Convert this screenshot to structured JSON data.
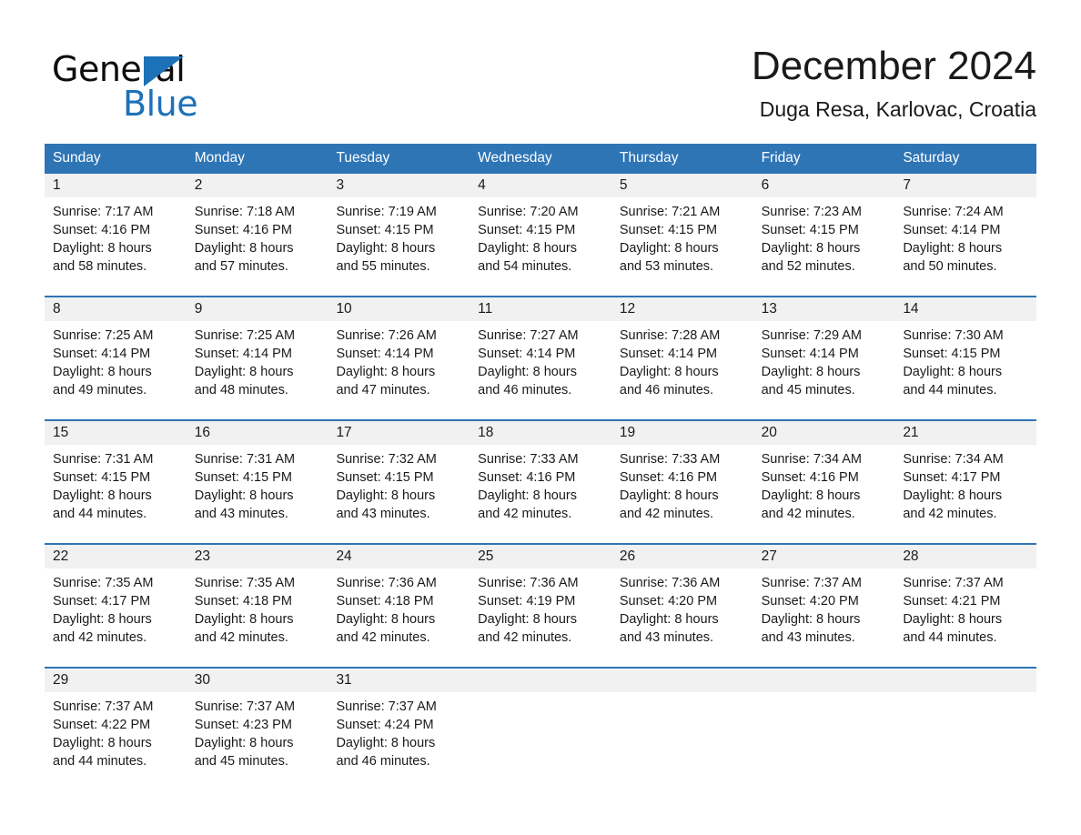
{
  "brand": {
    "name_part1": "General",
    "name_part2": "Blue",
    "triangle_color": "#1d71b8",
    "accent_color": "#2e75b6"
  },
  "header": {
    "month_title": "December 2024",
    "location": "Duga Resa, Karlovac, Croatia"
  },
  "calendar": {
    "weekdays": [
      "Sunday",
      "Monday",
      "Tuesday",
      "Wednesday",
      "Thursday",
      "Friday",
      "Saturday"
    ],
    "weeks": [
      {
        "days": [
          {
            "num": "1",
            "sunrise": "Sunrise: 7:17 AM",
            "sunset": "Sunset: 4:16 PM",
            "daylight1": "Daylight: 8 hours",
            "daylight2": "and 58 minutes."
          },
          {
            "num": "2",
            "sunrise": "Sunrise: 7:18 AM",
            "sunset": "Sunset: 4:16 PM",
            "daylight1": "Daylight: 8 hours",
            "daylight2": "and 57 minutes."
          },
          {
            "num": "3",
            "sunrise": "Sunrise: 7:19 AM",
            "sunset": "Sunset: 4:15 PM",
            "daylight1": "Daylight: 8 hours",
            "daylight2": "and 55 minutes."
          },
          {
            "num": "4",
            "sunrise": "Sunrise: 7:20 AM",
            "sunset": "Sunset: 4:15 PM",
            "daylight1": "Daylight: 8 hours",
            "daylight2": "and 54 minutes."
          },
          {
            "num": "5",
            "sunrise": "Sunrise: 7:21 AM",
            "sunset": "Sunset: 4:15 PM",
            "daylight1": "Daylight: 8 hours",
            "daylight2": "and 53 minutes."
          },
          {
            "num": "6",
            "sunrise": "Sunrise: 7:23 AM",
            "sunset": "Sunset: 4:15 PM",
            "daylight1": "Daylight: 8 hours",
            "daylight2": "and 52 minutes."
          },
          {
            "num": "7",
            "sunrise": "Sunrise: 7:24 AM",
            "sunset": "Sunset: 4:14 PM",
            "daylight1": "Daylight: 8 hours",
            "daylight2": "and 50 minutes."
          }
        ]
      },
      {
        "days": [
          {
            "num": "8",
            "sunrise": "Sunrise: 7:25 AM",
            "sunset": "Sunset: 4:14 PM",
            "daylight1": "Daylight: 8 hours",
            "daylight2": "and 49 minutes."
          },
          {
            "num": "9",
            "sunrise": "Sunrise: 7:25 AM",
            "sunset": "Sunset: 4:14 PM",
            "daylight1": "Daylight: 8 hours",
            "daylight2": "and 48 minutes."
          },
          {
            "num": "10",
            "sunrise": "Sunrise: 7:26 AM",
            "sunset": "Sunset: 4:14 PM",
            "daylight1": "Daylight: 8 hours",
            "daylight2": "and 47 minutes."
          },
          {
            "num": "11",
            "sunrise": "Sunrise: 7:27 AM",
            "sunset": "Sunset: 4:14 PM",
            "daylight1": "Daylight: 8 hours",
            "daylight2": "and 46 minutes."
          },
          {
            "num": "12",
            "sunrise": "Sunrise: 7:28 AM",
            "sunset": "Sunset: 4:14 PM",
            "daylight1": "Daylight: 8 hours",
            "daylight2": "and 46 minutes."
          },
          {
            "num": "13",
            "sunrise": "Sunrise: 7:29 AM",
            "sunset": "Sunset: 4:14 PM",
            "daylight1": "Daylight: 8 hours",
            "daylight2": "and 45 minutes."
          },
          {
            "num": "14",
            "sunrise": "Sunrise: 7:30 AM",
            "sunset": "Sunset: 4:15 PM",
            "daylight1": "Daylight: 8 hours",
            "daylight2": "and 44 minutes."
          }
        ]
      },
      {
        "days": [
          {
            "num": "15",
            "sunrise": "Sunrise: 7:31 AM",
            "sunset": "Sunset: 4:15 PM",
            "daylight1": "Daylight: 8 hours",
            "daylight2": "and 44 minutes."
          },
          {
            "num": "16",
            "sunrise": "Sunrise: 7:31 AM",
            "sunset": "Sunset: 4:15 PM",
            "daylight1": "Daylight: 8 hours",
            "daylight2": "and 43 minutes."
          },
          {
            "num": "17",
            "sunrise": "Sunrise: 7:32 AM",
            "sunset": "Sunset: 4:15 PM",
            "daylight1": "Daylight: 8 hours",
            "daylight2": "and 43 minutes."
          },
          {
            "num": "18",
            "sunrise": "Sunrise: 7:33 AM",
            "sunset": "Sunset: 4:16 PM",
            "daylight1": "Daylight: 8 hours",
            "daylight2": "and 42 minutes."
          },
          {
            "num": "19",
            "sunrise": "Sunrise: 7:33 AM",
            "sunset": "Sunset: 4:16 PM",
            "daylight1": "Daylight: 8 hours",
            "daylight2": "and 42 minutes."
          },
          {
            "num": "20",
            "sunrise": "Sunrise: 7:34 AM",
            "sunset": "Sunset: 4:16 PM",
            "daylight1": "Daylight: 8 hours",
            "daylight2": "and 42 minutes."
          },
          {
            "num": "21",
            "sunrise": "Sunrise: 7:34 AM",
            "sunset": "Sunset: 4:17 PM",
            "daylight1": "Daylight: 8 hours",
            "daylight2": "and 42 minutes."
          }
        ]
      },
      {
        "days": [
          {
            "num": "22",
            "sunrise": "Sunrise: 7:35 AM",
            "sunset": "Sunset: 4:17 PM",
            "daylight1": "Daylight: 8 hours",
            "daylight2": "and 42 minutes."
          },
          {
            "num": "23",
            "sunrise": "Sunrise: 7:35 AM",
            "sunset": "Sunset: 4:18 PM",
            "daylight1": "Daylight: 8 hours",
            "daylight2": "and 42 minutes."
          },
          {
            "num": "24",
            "sunrise": "Sunrise: 7:36 AM",
            "sunset": "Sunset: 4:18 PM",
            "daylight1": "Daylight: 8 hours",
            "daylight2": "and 42 minutes."
          },
          {
            "num": "25",
            "sunrise": "Sunrise: 7:36 AM",
            "sunset": "Sunset: 4:19 PM",
            "daylight1": "Daylight: 8 hours",
            "daylight2": "and 42 minutes."
          },
          {
            "num": "26",
            "sunrise": "Sunrise: 7:36 AM",
            "sunset": "Sunset: 4:20 PM",
            "daylight1": "Daylight: 8 hours",
            "daylight2": "and 43 minutes."
          },
          {
            "num": "27",
            "sunrise": "Sunrise: 7:37 AM",
            "sunset": "Sunset: 4:20 PM",
            "daylight1": "Daylight: 8 hours",
            "daylight2": "and 43 minutes."
          },
          {
            "num": "28",
            "sunrise": "Sunrise: 7:37 AM",
            "sunset": "Sunset: 4:21 PM",
            "daylight1": "Daylight: 8 hours",
            "daylight2": "and 44 minutes."
          }
        ]
      },
      {
        "days": [
          {
            "num": "29",
            "sunrise": "Sunrise: 7:37 AM",
            "sunset": "Sunset: 4:22 PM",
            "daylight1": "Daylight: 8 hours",
            "daylight2": "and 44 minutes."
          },
          {
            "num": "30",
            "sunrise": "Sunrise: 7:37 AM",
            "sunset": "Sunset: 4:23 PM",
            "daylight1": "Daylight: 8 hours",
            "daylight2": "and 45 minutes."
          },
          {
            "num": "31",
            "sunrise": "Sunrise: 7:37 AM",
            "sunset": "Sunset: 4:24 PM",
            "daylight1": "Daylight: 8 hours",
            "daylight2": "and 46 minutes."
          },
          {
            "num": "",
            "sunrise": "",
            "sunset": "",
            "daylight1": "",
            "daylight2": ""
          },
          {
            "num": "",
            "sunrise": "",
            "sunset": "",
            "daylight1": "",
            "daylight2": ""
          },
          {
            "num": "",
            "sunrise": "",
            "sunset": "",
            "daylight1": "",
            "daylight2": ""
          },
          {
            "num": "",
            "sunrise": "",
            "sunset": "",
            "daylight1": "",
            "daylight2": ""
          }
        ]
      }
    ]
  }
}
